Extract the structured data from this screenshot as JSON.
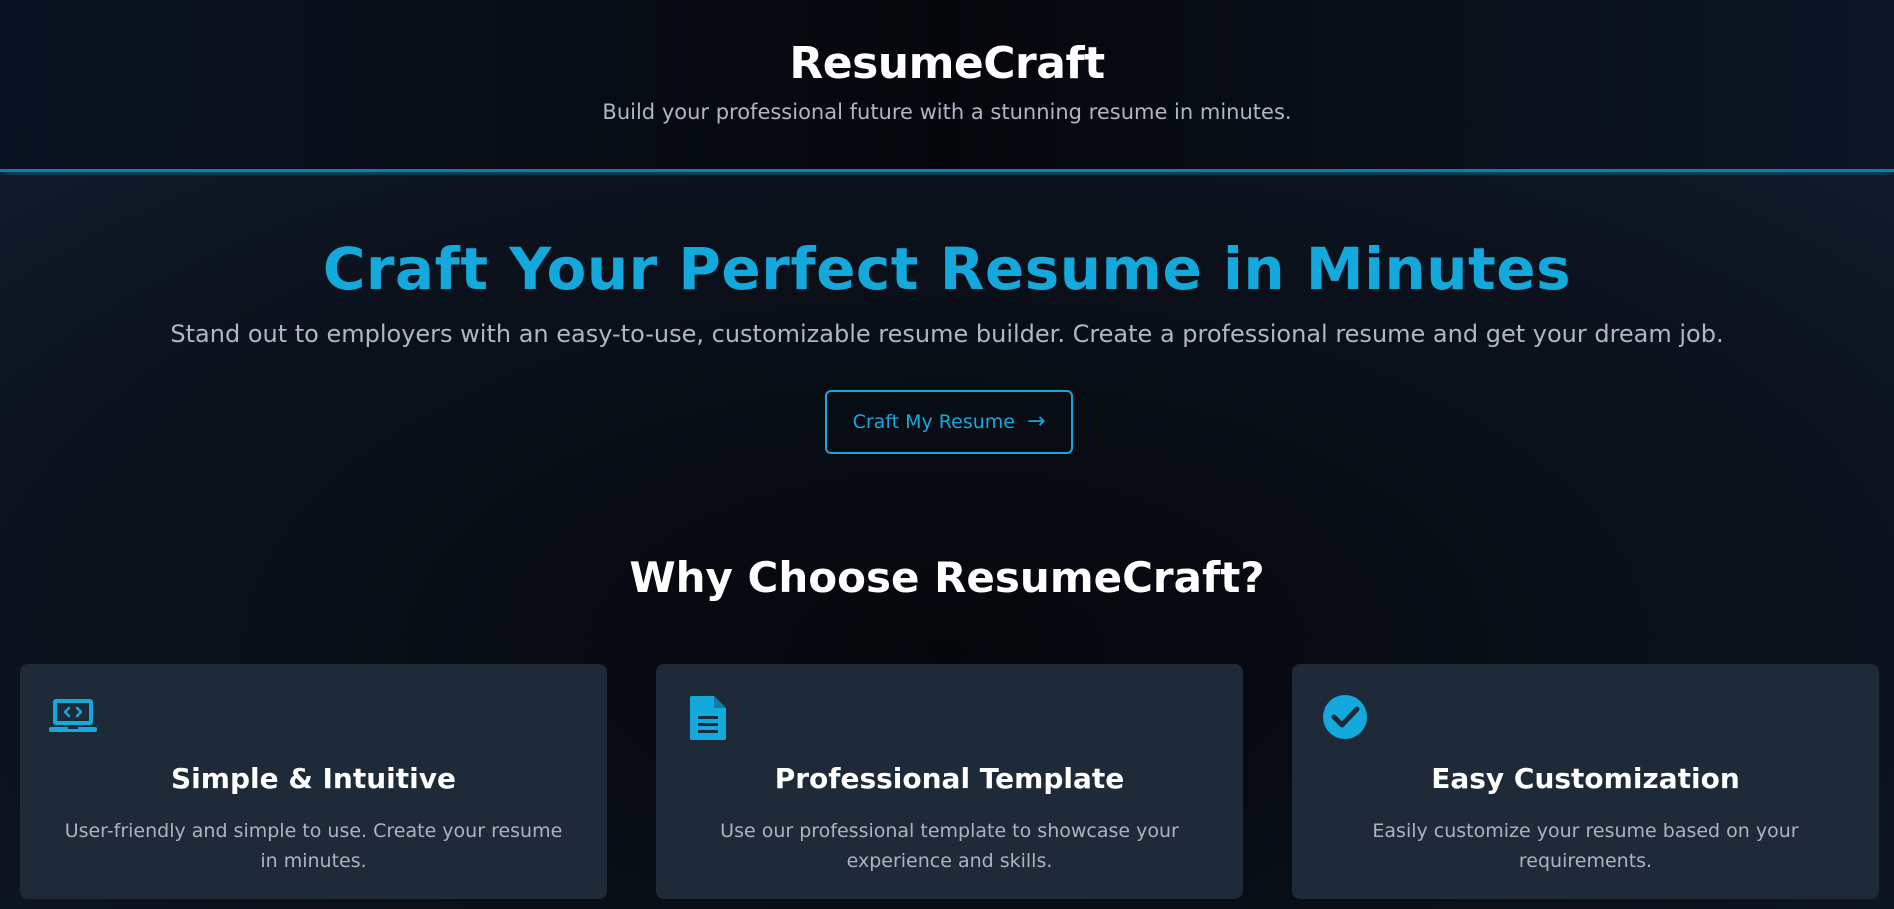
{
  "header": {
    "title": "ResumeCraft",
    "tagline": "Build your professional future with a stunning resume in minutes."
  },
  "hero": {
    "title": "Craft Your Perfect Resume in Minutes",
    "subtitle": "Stand out to employers with an easy-to-use, customizable resume builder. Create a professional resume and get your dream job.",
    "cta_label": "Craft My Resume",
    "cta_icon": "arrow-right-icon"
  },
  "features": {
    "title": "Why Choose ResumeCraft?",
    "items": [
      {
        "icon": "laptop-code-icon",
        "title": "Simple & Intuitive",
        "description": "User-friendly and simple to use. Create your resume in minutes."
      },
      {
        "icon": "document-icon",
        "title": "Professional Template",
        "description": "Use our professional template to showcase your experience and skills."
      },
      {
        "icon": "check-circle-icon",
        "title": "Easy Customization",
        "description": "Easily customize your resume based on your requirements."
      }
    ]
  },
  "colors": {
    "accent": "#13a9dc",
    "background": "#070a10",
    "card": "#1f2a38",
    "text_muted": "#aeb7c4"
  }
}
